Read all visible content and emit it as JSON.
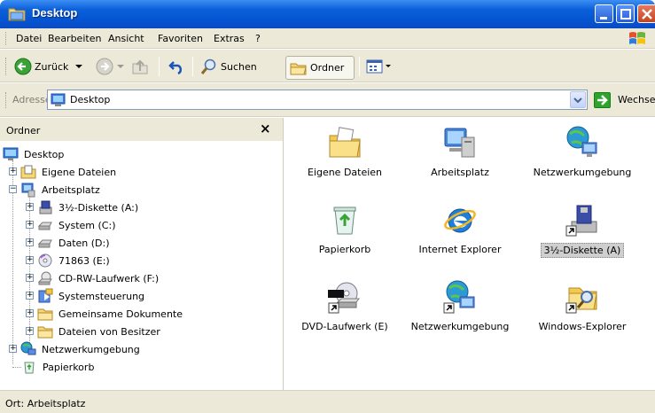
{
  "window": {
    "title": "Desktop"
  },
  "menu": {
    "items": [
      {
        "label": "Datei"
      },
      {
        "label": "Bearbeiten"
      },
      {
        "label": "Ansicht"
      },
      {
        "label": "Favoriten"
      },
      {
        "label": "Extras"
      },
      {
        "label": "?"
      }
    ]
  },
  "toolbar": {
    "back_label": "Zurück",
    "search_label": "Suchen",
    "folders_label": "Ordner"
  },
  "address": {
    "label": "Adresse",
    "value": "Desktop",
    "go_label": "Wechseln zu"
  },
  "folder_panel": {
    "title": "Ordner",
    "close": "×",
    "tree": [
      {
        "label": "Desktop",
        "icon": "desktop-icon"
      },
      {
        "label": "Eigene Dateien",
        "icon": "my-documents-icon"
      },
      {
        "label": "Arbeitsplatz",
        "icon": "my-computer-icon"
      },
      {
        "label": "3½-Diskette (A:)",
        "icon": "floppy-icon"
      },
      {
        "label": "System (C:)",
        "icon": "hard-drive-icon"
      },
      {
        "label": "Daten (D:)",
        "icon": "hard-drive-icon"
      },
      {
        "label": "71863 (E:)",
        "icon": "dvd-drive-icon"
      },
      {
        "label": "CD-RW-Laufwerk (F:)",
        "icon": "cd-drive-icon"
      },
      {
        "label": "Systemsteuerung",
        "icon": "control-panel-icon"
      },
      {
        "label": "Gemeinsame Dokumente",
        "icon": "folder-icon"
      },
      {
        "label": "Dateien von Besitzer",
        "icon": "folder-icon"
      },
      {
        "label": "Netzwerkumgebung",
        "icon": "network-icon"
      },
      {
        "label": "Papierkorb",
        "icon": "recycle-bin-icon"
      }
    ]
  },
  "content": {
    "items": [
      {
        "label": "Eigene Dateien",
        "icon": "my-documents-icon"
      },
      {
        "label": "Arbeitsplatz",
        "icon": "my-computer-icon"
      },
      {
        "label": "Netzwerkumgebung",
        "icon": "network-icon"
      },
      {
        "label": "Papierkorb",
        "icon": "recycle-bin-icon"
      },
      {
        "label": "Internet Explorer",
        "icon": "internet-explorer-icon"
      },
      {
        "label": "3½-Diskette (A)",
        "icon": "floppy-shortcut-icon"
      },
      {
        "label": "DVD-Laufwerk (E)",
        "icon": "dvd-shortcut-icon"
      },
      {
        "label": "Netzwerkumgebung",
        "icon": "network-shortcut-icon"
      },
      {
        "label": "Windows-Explorer",
        "icon": "explorer-shortcut-icon"
      }
    ]
  },
  "status": {
    "text": "Ort: Arbeitsplatz"
  },
  "colors": {
    "titlebar": "#0554d3",
    "chrome": "#ece9d8",
    "selection": "#cfcfcf"
  }
}
